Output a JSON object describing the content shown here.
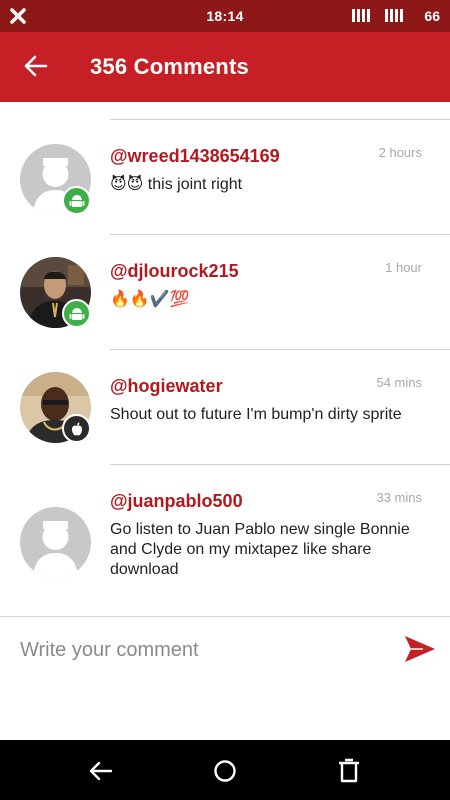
{
  "status_bar": {
    "time": "18:14",
    "battery": "66"
  },
  "header": {
    "title": "356 Comments"
  },
  "comments": [
    {
      "username": "@wreed1438654169",
      "time": "2 hours",
      "text": "😈😈 this joint right",
      "avatar": "default-avatar",
      "platform": "android"
    },
    {
      "username": "@djlourock215",
      "time": "1 hour",
      "text": "🔥🔥✔️💯",
      "avatar": "photo",
      "platform": "android"
    },
    {
      "username": "@hogiewater",
      "time": "54 mins",
      "text": "Shout out to future I'm bump'n dirty sprite",
      "avatar": "photo",
      "platform": "apple"
    },
    {
      "username": "@juanpablo500",
      "time": "33 mins",
      "text": "Go listen to Juan Pablo new single Bonnie and Clyde on my mixtapez like share download",
      "avatar": "default-avatar",
      "platform": "none"
    }
  ],
  "comment_input": {
    "placeholder": "Write your comment",
    "value": ""
  },
  "colors": {
    "status_bar": "#8e1818",
    "app_bar": "#c62026",
    "username": "#b3181f",
    "android_badge": "#3fae4a",
    "apple_badge": "#2a2a2a"
  },
  "icons": {
    "back": "arrow-left-icon",
    "send": "send-icon",
    "nav_back": "nav-back-icon",
    "nav_home": "nav-home-icon",
    "nav_recents": "nav-recents-icon"
  }
}
